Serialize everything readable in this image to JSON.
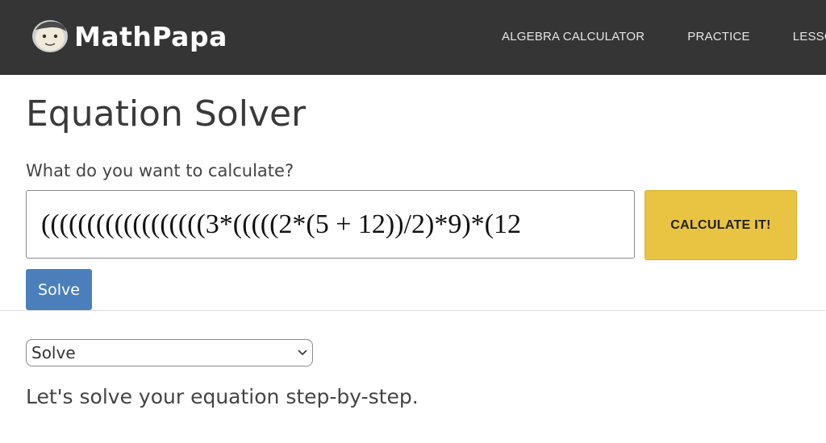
{
  "header": {
    "brand_name": "MathPapa",
    "nav": [
      {
        "label": "ALGEBRA CALCULATOR"
      },
      {
        "label": "PRACTICE"
      },
      {
        "label": "LESSONS"
      }
    ]
  },
  "main": {
    "title": "Equation Solver",
    "prompt": "What do you want to calculate?",
    "equation_value": "((((((((((((((((((3*(((((2*(5 + 12))/2)*9)*(12",
    "calculate_label": "CALCULATE IT!",
    "solve_label": "Solve",
    "mode_select": {
      "selected": "Solve"
    },
    "step_message": "Let's solve your equation step-by-step."
  },
  "colors": {
    "header_bg": "#353535",
    "calculate_button": "#e9c442",
    "solve_button": "#4a7fbc"
  },
  "icons": {
    "logo": "mathpapa-logo-icon",
    "select_arrow": "chevron-down-icon"
  }
}
